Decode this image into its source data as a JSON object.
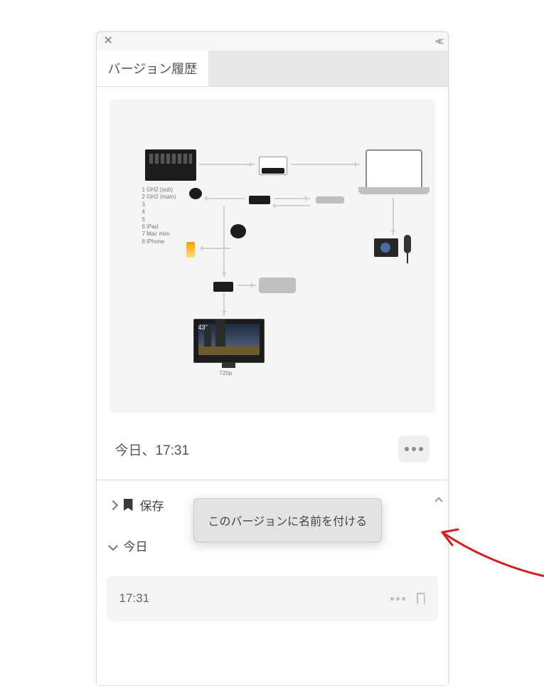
{
  "panel": {
    "tab_title": "バージョン履歴"
  },
  "preview": {
    "device_list": [
      "1  GH2 (sub)",
      "2  GH2 (main)",
      "3",
      "4",
      "5",
      "6  iPad",
      "7  Mac mini",
      "8  iPhone"
    ],
    "tv_label": "720p",
    "tv_size": "43\""
  },
  "current": {
    "timestamp": "今日、17:31"
  },
  "sections": {
    "saved_label": "保存",
    "today_label": "今日"
  },
  "history": [
    {
      "time": "17:31"
    }
  ],
  "menu": {
    "rename_label": "このバージョンに名前を付ける"
  }
}
